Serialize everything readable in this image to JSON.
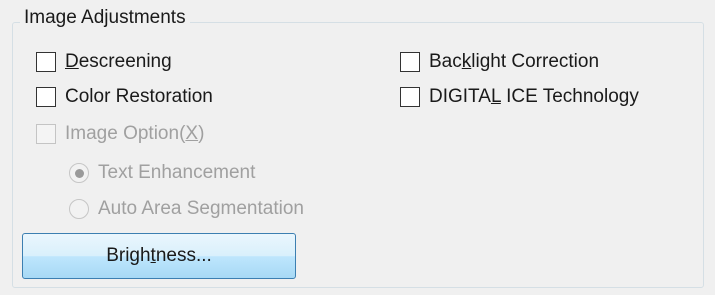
{
  "group": {
    "title": "Image Adjustments"
  },
  "options": {
    "descreening": {
      "pre": "",
      "mnemonic": "D",
      "post": "escreening",
      "checked": false
    },
    "color_restoration": {
      "label": "Color Restoration",
      "checked": false
    },
    "image_option": {
      "label": "Image Option(",
      "mnemonic": "X",
      "post": ")",
      "checked": false,
      "enabled": false
    },
    "backlight_correction": {
      "pre": "Bac",
      "mnemonic": "k",
      "post": "light Correction",
      "checked": false
    },
    "digital_ice": {
      "pre": "DIGITA",
      "mnemonic": "L",
      "post": " ICE Technology",
      "checked": false
    }
  },
  "radios": {
    "text_enhancement": {
      "label": "Text Enhancement",
      "selected": true,
      "enabled": false
    },
    "auto_area_segmentation": {
      "label": "Auto Area Segmentation",
      "selected": false,
      "enabled": false
    }
  },
  "buttons": {
    "brightness": {
      "pre": "Brigh",
      "mnemonic": "t",
      "post": "ness..."
    }
  },
  "colors": {
    "background": "#f0f0f0",
    "disabled_text": "#a0a0a0",
    "button_border": "#3c7fb1"
  }
}
